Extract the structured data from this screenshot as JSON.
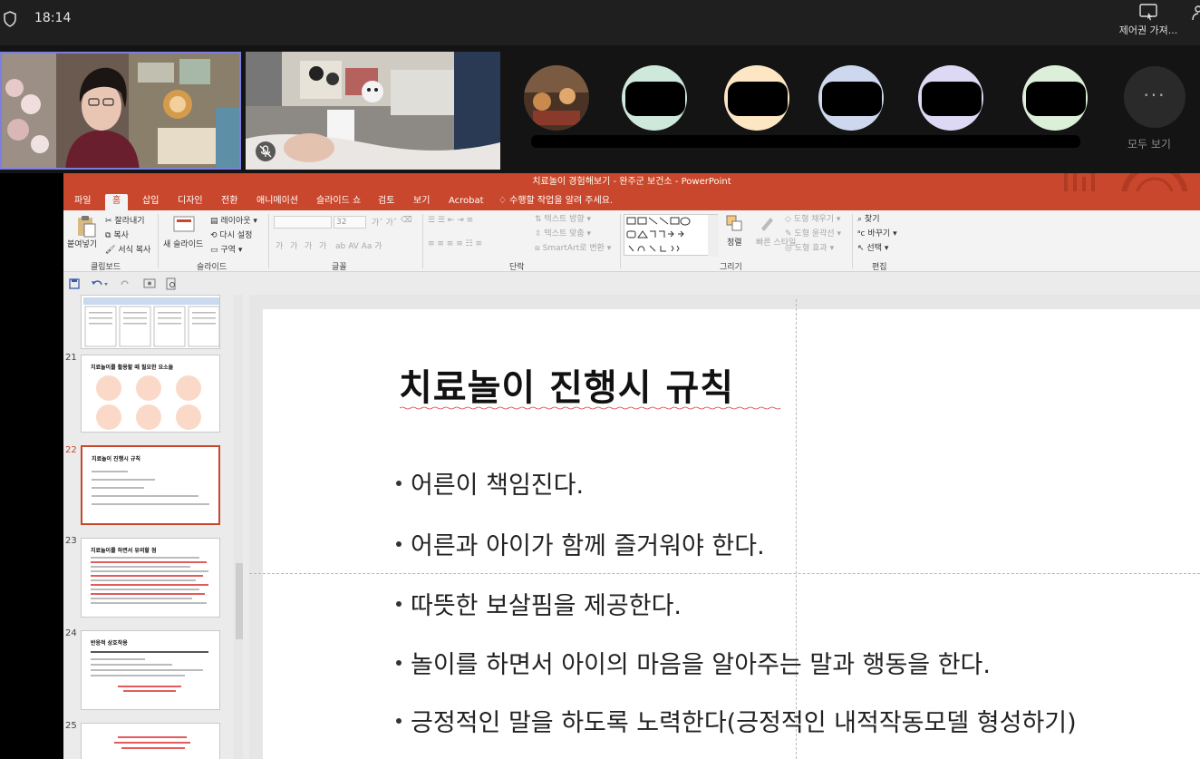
{
  "teams": {
    "time": "18:14",
    "control_label": "제어권 가져...",
    "more_label": "모두 보기",
    "more_glyph": "···"
  },
  "ppt": {
    "title": "치료놀이 경험해보기 - 완주군 보건소 - PowerPoint",
    "tabs": [
      "파일",
      "홈",
      "삽입",
      "디자인",
      "전환",
      "애니메이션",
      "슬라이드 쇼",
      "검토",
      "보기",
      "Acrobat",
      "수행할 작업을 알려 주세요."
    ],
    "active_tab": "홈",
    "ribbon": {
      "clipboard": {
        "paste": "붙여넣기",
        "cut": "잘라내기",
        "copy": "복사",
        "format_painter": "서식 복사",
        "label": "클립보드"
      },
      "slides": {
        "new_slide": "새 슬라이드",
        "layout": "레이아웃",
        "reset": "다시 설정",
        "section": "구역",
        "label": "슬라이드"
      },
      "font": {
        "size": "32",
        "label": "글꼴",
        "bold": "가",
        "italic": "가",
        "underline": "가",
        "strike": "가"
      },
      "paragraph": {
        "text_direction": "텍스트 방향",
        "align_text": "텍스트 맞춤",
        "smartart": "SmartArt로 변환",
        "label": "단락"
      },
      "drawing": {
        "arrange": "정렬",
        "quick_styles": "빠른 스타일",
        "shape_fill": "도형 채우기",
        "shape_outline": "도형 윤곽선",
        "shape_effects": "도형 효과",
        "label": "그리기"
      },
      "editing": {
        "find": "찾기",
        "replace": "바꾸기",
        "select": "선택",
        "label": "편집"
      }
    }
  },
  "thumbnails": [
    {
      "num": "21",
      "title": "치료놀이를 활용할 때 필요한 요소들"
    },
    {
      "num": "22",
      "title": "치료놀이 진행시 규칙"
    },
    {
      "num": "23",
      "title": "치료놀이를 하면서 유의할 점"
    },
    {
      "num": "24",
      "title": "반응적 상호작용"
    },
    {
      "num": "25",
      "title": ""
    }
  ],
  "slide": {
    "title": "치료놀이 진행시 규칙",
    "bullets": [
      "어른이 책임진다.",
      "어른과 아이가 함께 즐거워야 한다.",
      "따뜻한 보살핌을 제공한다.",
      "놀이를 하면서 아이의 마음을 알아주는 말과 행동을 한다.",
      "긍정적인 말을 하도록 노력한다(긍정적인 내적작동모델 형성하기)"
    ]
  },
  "colors": {
    "accent": "#c9472d",
    "speaker_border": "#7c7fe0",
    "avatar_colors": [
      "#cfe8dc",
      "#fde6c3",
      "#cdd8ee",
      "#ddd9f5",
      "#dcefd9"
    ]
  }
}
